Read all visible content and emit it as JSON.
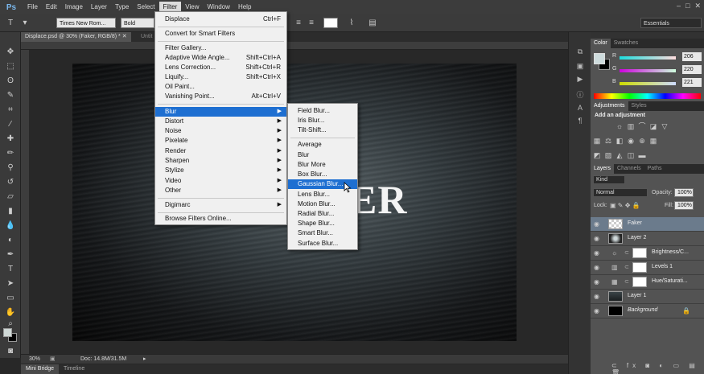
{
  "app": {
    "logo": "Ps",
    "win_controls": [
      "–",
      "□",
      "✕"
    ]
  },
  "menubar": {
    "items": [
      "File",
      "Edit",
      "Image",
      "Layer",
      "Type",
      "Select",
      "Filter",
      "View",
      "Window",
      "Help"
    ]
  },
  "options": {
    "tool_icon": "T",
    "font_family": "Times New Rom...",
    "font_style": "Bold",
    "workspace": "Essentials"
  },
  "doc_tabs": [
    {
      "label": "Displace.psd @ 30% (Faker, RGB/8) *  ✕"
    },
    {
      "label": "Untit"
    }
  ],
  "canvas": {
    "text": "ER"
  },
  "status": {
    "zoom": "30%",
    "doc": "Doc: 14.8M/31.5M"
  },
  "bottom_tabs": [
    "Mini Bridge",
    "Timeline"
  ],
  "filter_menu": {
    "displace": {
      "label": "Displace",
      "shortcut": "Ctrl+F"
    },
    "convert": "Convert for Smart Filters",
    "gallery": "Filter Gallery...",
    "adaptive": {
      "label": "Adaptive Wide Angle...",
      "shortcut": "Shift+Ctrl+A"
    },
    "lens": {
      "label": "Lens Correction...",
      "shortcut": "Shift+Ctrl+R"
    },
    "liquify": {
      "label": "Liquify...",
      "shortcut": "Shift+Ctrl+X"
    },
    "oil": "Oil Paint...",
    "vanishing": {
      "label": "Vanishing Point...",
      "shortcut": "Alt+Ctrl+V"
    },
    "blur": "Blur",
    "distort": "Distort",
    "noise": "Noise",
    "pixelate": "Pixelate",
    "render": "Render",
    "sharpen": "Sharpen",
    "stylize": "Stylize",
    "video": "Video",
    "other": "Other",
    "digimarc": "Digimarc",
    "browse": "Browse Filters Online..."
  },
  "blur_menu": {
    "field": "Field Blur...",
    "iris": "Iris Blur...",
    "tilt": "Tilt-Shift...",
    "average": "Average",
    "blur": "Blur",
    "blur_more": "Blur More",
    "box": "Box Blur...",
    "gaussian": "Gaussian Blur...",
    "lens": "Lens Blur...",
    "motion": "Motion Blur...",
    "radial": "Radial Blur...",
    "shape": "Shape Blur...",
    "smart": "Smart Blur...",
    "surface": "Surface Blur..."
  },
  "color_panel": {
    "tabs": [
      "Color",
      "Swatches"
    ],
    "r_label": "R",
    "r": "206",
    "g_label": "G",
    "g": "220",
    "b_label": "B",
    "b": "221",
    "fg_color": "#cedcdd"
  },
  "adjust_panel": {
    "tabs": [
      "Adjustments",
      "Styles"
    ],
    "title": "Add an adjustment"
  },
  "layers_panel": {
    "tabs": [
      "Layers",
      "Channels",
      "Paths"
    ],
    "kind": "Kind",
    "blend": "Normal",
    "opacity_label": "Opacity:",
    "opacity": "100%",
    "lock_label": "Lock:",
    "fill_label": "Fill:",
    "fill": "100%",
    "layers": {
      "faker": "Faker",
      "layer2": "Layer 2",
      "brightness": "Brightness/C...",
      "levels": "Levels 1",
      "hue": "Hue/Saturati...",
      "layer1": "Layer 1",
      "background": "Background"
    }
  }
}
